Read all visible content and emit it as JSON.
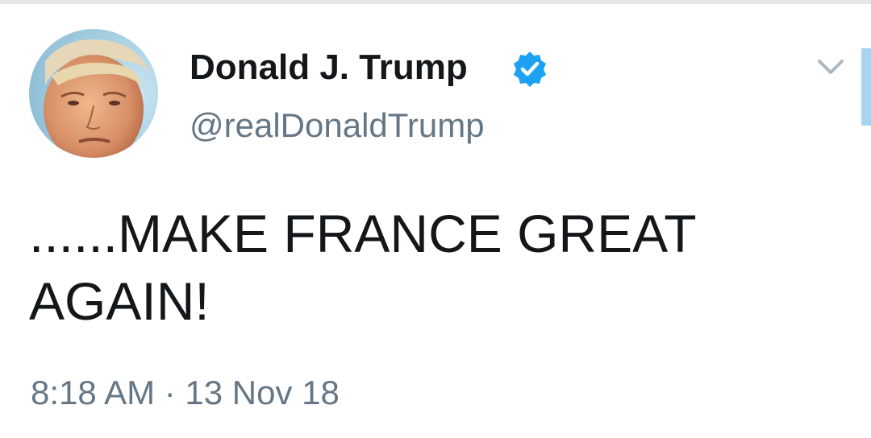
{
  "tweet": {
    "author": {
      "display_name": "Donald J. Trump",
      "handle": "@realDonaldTrump",
      "verified": true
    },
    "text_line1": "......MAKE FRANCE GREAT",
    "text_line2": "AGAIN!",
    "timestamp": "8:18 AM · 13 Nov 18"
  },
  "colors": {
    "primary_text": "#14171a",
    "secondary_text": "#657786",
    "verified_blue": "#1da1f2",
    "chevron": "#aab8c2",
    "scroll_indicator": "#a8d4f2"
  },
  "icons": {
    "verified": "verified-badge-icon",
    "menu": "chevron-down-icon"
  }
}
